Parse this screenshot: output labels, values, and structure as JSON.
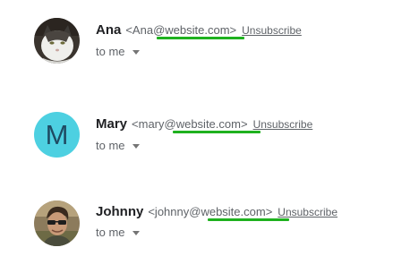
{
  "emails": [
    {
      "name": "Ana",
      "address_prefix": "<Ana",
      "address_domain": "@website.com",
      "address_suffix": ">",
      "unsubscribe_label": "Unsubscribe",
      "recipient_label": "to me",
      "avatar_type": "photo-cat"
    },
    {
      "name": "Mary",
      "address_prefix": "<mary",
      "address_domain": "@website.com",
      "address_suffix": ">",
      "unsubscribe_label": "Unsubscribe",
      "recipient_label": "to me",
      "avatar_type": "letter",
      "avatar_letter": "M",
      "avatar_color": "#4dd0e1"
    },
    {
      "name": "Johnny",
      "address_prefix": "<johnny",
      "address_domain": "@website.com",
      "address_suffix": ">",
      "unsubscribe_label": "Unsubscribe",
      "recipient_label": "to me",
      "avatar_type": "photo-person"
    }
  ],
  "colors": {
    "highlight_underline": "#1fb11f",
    "text_primary": "#202124",
    "text_secondary": "#5f6368"
  },
  "icons": {
    "expand_recipients": "caret-down-icon"
  }
}
